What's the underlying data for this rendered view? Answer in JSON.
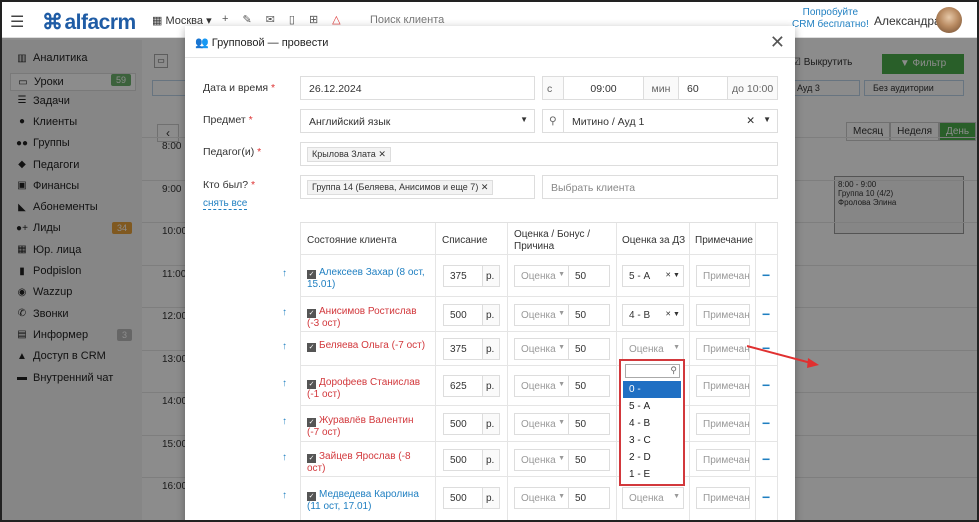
{
  "topbar": {
    "logo": "alfacrm",
    "city": "Москва",
    "search_placeholder": "Поиск клиента",
    "promo_line1": "Попробуйте",
    "promo_line2": "CRM бесплатно!",
    "user": "Александра"
  },
  "sidebar": {
    "items": [
      {
        "label": "Аналитика",
        "icon": "chart-icon"
      },
      {
        "label": "Уроки",
        "icon": "calendar-icon",
        "badge": "59"
      },
      {
        "label": "Задачи",
        "icon": "tasks-icon"
      },
      {
        "label": "Клиенты",
        "icon": "user-icon"
      },
      {
        "label": "Группы",
        "icon": "group-icon"
      },
      {
        "label": "Педагоги",
        "icon": "teacher-icon"
      },
      {
        "label": "Финансы",
        "icon": "money-icon"
      },
      {
        "label": "Абонементы",
        "icon": "tag-icon"
      },
      {
        "label": "Лиды",
        "icon": "leads-icon",
        "badge": "34"
      },
      {
        "label": "Юр. лица",
        "icon": "bank-icon"
      },
      {
        "label": "Podpislon",
        "icon": "doc-icon"
      },
      {
        "label": "Wazzup",
        "icon": "chat-icon"
      },
      {
        "label": "Звонки",
        "icon": "phone-icon"
      },
      {
        "label": "Информер",
        "icon": "informer-icon",
        "badge": "3"
      },
      {
        "label": "Доступ в CRM",
        "icon": "lock-icon"
      },
      {
        "label": "Внутренний чат",
        "icon": "message-icon"
      }
    ]
  },
  "calendar": {
    "times": [
      "8:00",
      "9:00",
      "10:00",
      "11:00",
      "12:00",
      "13:00",
      "14:00",
      "15:00",
      "16:00"
    ],
    "filter_label": "Фильтр",
    "cb_label": "Выкрутить",
    "aud_label": "Ауд 3",
    "noaud_label": "Без аудитории",
    "views": [
      "Месяц",
      "Неделя",
      "День"
    ],
    "event_time": "8:00 - 9:00",
    "event_group": "Группа 10 (4/2)",
    "event_teacher": "Фролова Элина"
  },
  "modal": {
    "title": "Групповой — провести",
    "date_label": "Дата и время",
    "date_value": "26.12.2024",
    "from_label": "с",
    "time_value": "09:00",
    "min_label": "мин",
    "duration": "60",
    "to_label": "до 10:00",
    "subject_label": "Предмет",
    "subject_value": "Английский язык",
    "room_value": "Митино / Ауд 1",
    "teacher_label": "Педагог(и)",
    "teacher_tag": "Крылова Злата",
    "who_label": "Кто был?",
    "who_tag": "Группа 14 (Беляева, Анисимов и еще 7)",
    "client_placeholder": "Выбрать клиента",
    "clear_link": "снять все",
    "headers": {
      "state": "Состояние клиента",
      "charge": "Списание",
      "grade": "Оценка / Бонус / Причина",
      "hw": "Оценка за ДЗ",
      "note": "Примечание"
    },
    "rows": [
      {
        "name": "Алексеев Захар (8 ост, 15.01)",
        "color": "blue",
        "charge": "375",
        "grade_ph": "Оценка",
        "bonus": "50",
        "hw": "5 - А",
        "note_ph": "Примечан"
      },
      {
        "name": "Анисимов Ростислав (-3 ост)",
        "color": "red",
        "charge": "500",
        "grade_ph": "Оценка",
        "bonus": "50",
        "hw": "4 - В",
        "note_ph": "Примечан"
      },
      {
        "name": "Беляева Ольга (-7 ост)",
        "color": "red",
        "charge": "375",
        "grade_ph": "Оценка",
        "bonus": "50",
        "hw": "Оценка",
        "note_ph": "Примечан"
      },
      {
        "name": "Дорофеев Станислав (-1 ост)",
        "color": "red",
        "charge": "625",
        "grade_ph": "Оценка",
        "bonus": "50",
        "hw": "",
        "note_ph": "Примечан"
      },
      {
        "name": "Журавлёв Валентин (-7 ост)",
        "color": "red",
        "charge": "500",
        "grade_ph": "Оценка",
        "bonus": "50",
        "hw": "",
        "note_ph": "Примечан"
      },
      {
        "name": "Зайцев Ярослав (-8 ост)",
        "color": "red",
        "charge": "500",
        "grade_ph": "Оценка",
        "bonus": "50",
        "hw": "",
        "note_ph": "Примечан"
      },
      {
        "name": "Медведева Каролина (11 ост, 17.01)",
        "color": "blue",
        "charge": "500",
        "grade_ph": "Оценка",
        "bonus": "50",
        "hw": "Оценка",
        "note_ph": "Примечан"
      }
    ],
    "currency": "р.",
    "dropdown": [
      "0 -",
      "5 - А",
      "4 - В",
      "3 - С",
      "2 - D",
      "1 - E"
    ]
  }
}
